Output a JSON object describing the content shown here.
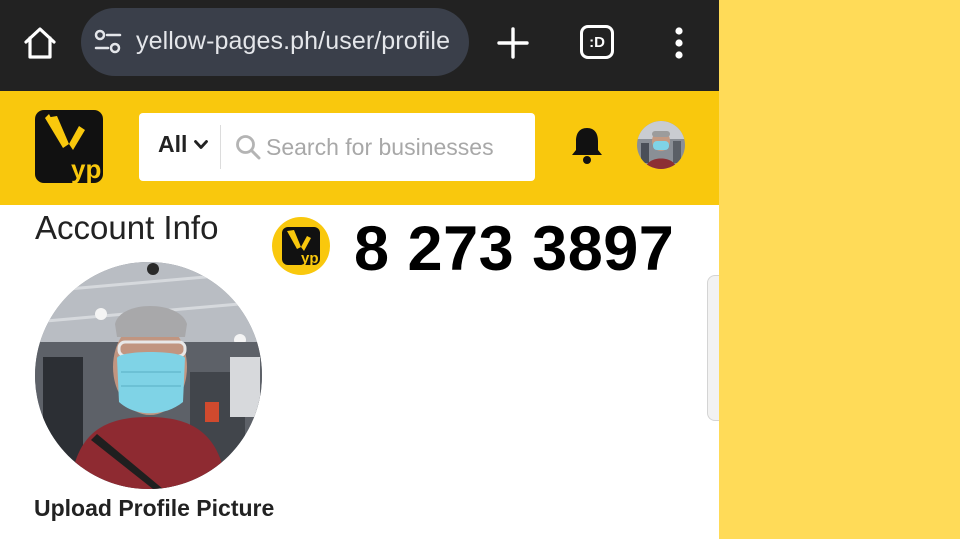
{
  "browser": {
    "url": "yellow-pages.ph/user/profile",
    "tab_count": ":D",
    "icons": [
      "home-icon",
      "site-settings-icon",
      "plus-icon",
      "tabs-icon",
      "more-vertical-icon"
    ]
  },
  "header": {
    "logo_text": "yp",
    "search": {
      "category": "All",
      "placeholder": "Search for businesses",
      "value": ""
    },
    "icons": [
      "bell-icon",
      "avatar"
    ]
  },
  "account": {
    "title": "Account Info",
    "phone_number": "8 273 3897",
    "badge_text": "yp",
    "upload_label": "Upload Profile Picture"
  },
  "colors": {
    "brand_yellow": "#f9c80d",
    "side_yellow": "#ffdb58",
    "browser_dark": "#222222",
    "url_pill": "#3a3f4a"
  }
}
